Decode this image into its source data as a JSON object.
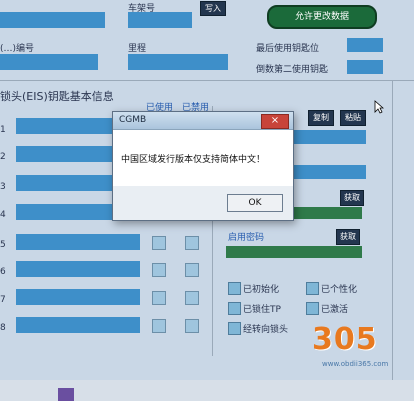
{
  "top": {
    "frame_no_label": "车架号",
    "write_button": "写入",
    "allow_change_button": "允许更改数据",
    "field_label_2": "(…)编号",
    "mileage_label": "里程",
    "last_used_key_label": "最后使用钥匙位",
    "second_last_key_label": "倒数第二使用钥匙"
  },
  "eis_section": {
    "title": "锁头(EIS)钥匙基本信息",
    "used_label": "已使用",
    "disabled_label": "已禁用",
    "row_labels": [
      "1",
      "2",
      "3",
      "4",
      "5",
      "6",
      "7",
      "8"
    ]
  },
  "right_panel": {
    "copy_button": "复制",
    "paste_button": "粘贴",
    "get_button_1": "获取",
    "get_button_2": "获取",
    "boot_password_label": "启用密码"
  },
  "status": {
    "initialized": "已初始化",
    "personalized": "已个性化",
    "locked_tp": "已锁住TP",
    "activated": "已激活",
    "via_steering_lock": "经转向锁头"
  },
  "dialog": {
    "title": "CGMB",
    "close_icon": "×",
    "message": "中国区域发行版本仅支持简体中文！",
    "ok_button": "OK"
  },
  "watermark": {
    "digits": "305",
    "text": "www.obdii365.com"
  },
  "colors": {
    "field_blue": "#3e8fc9",
    "dark_button": "#23364f",
    "green_button": "#1b6a3a",
    "close_red": "#c8443a",
    "watermark_orange": "#e8791f"
  }
}
